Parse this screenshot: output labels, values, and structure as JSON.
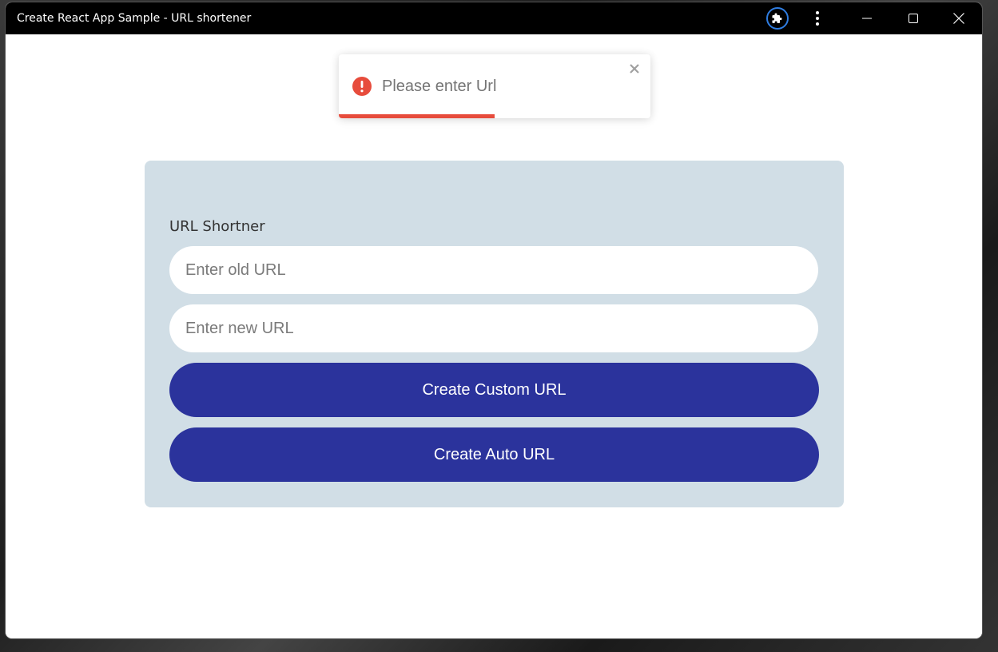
{
  "window": {
    "title": "Create React App Sample - URL shortener"
  },
  "toast": {
    "message": "Please enter Url",
    "type": "error",
    "progress_fraction": 0.5,
    "accent_color": "#e74c3c"
  },
  "form": {
    "label": "URL Shortner",
    "old_url": {
      "placeholder": "Enter old URL",
      "value": ""
    },
    "new_url": {
      "placeholder": "Enter new URL",
      "value": ""
    },
    "custom_button_label": "Create Custom URL",
    "auto_button_label": "Create Auto URL"
  },
  "colors": {
    "titlebar_bg": "#000000",
    "card_bg": "#d1dee6",
    "button_bg": "#2b339c",
    "extension_ring": "#2f7de1",
    "error_icon": "#e74c3c"
  },
  "icons": {
    "extension": "puzzle-icon",
    "menu": "more-vertical-icon",
    "minimize": "minimize-icon",
    "maximize": "maximize-icon",
    "close": "close-icon",
    "toast_status": "error-circle-icon",
    "toast_close": "close-icon"
  }
}
